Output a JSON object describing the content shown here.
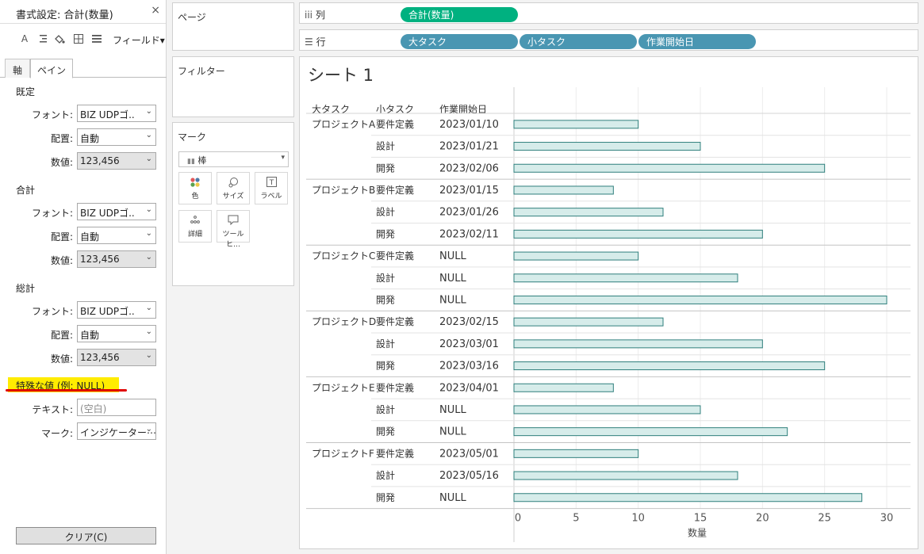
{
  "format_pane": {
    "title": "書式設定: 合計(数量)",
    "close": "×",
    "toolbar": {
      "font_icon": "A",
      "field_label": "フィールド▾"
    },
    "tabs": [
      "軸",
      "ペイン"
    ],
    "sections": [
      {
        "title": "既定",
        "rows": [
          {
            "label": "フォント:",
            "value": "BIZ UDPゴ..",
            "style": "white"
          },
          {
            "label": "配置:",
            "value": "自動",
            "style": "white"
          },
          {
            "label": "数値:",
            "value": "123,456",
            "style": "grey"
          }
        ]
      },
      {
        "title": "合計",
        "rows": [
          {
            "label": "フォント:",
            "value": "BIZ UDPゴ..",
            "style": "white"
          },
          {
            "label": "配置:",
            "value": "自動",
            "style": "white"
          },
          {
            "label": "数値:",
            "value": "123,456",
            "style": "grey"
          }
        ]
      },
      {
        "title": "総計",
        "rows": [
          {
            "label": "フォント:",
            "value": "BIZ UDPゴ..",
            "style": "white"
          },
          {
            "label": "配置:",
            "value": "自動",
            "style": "white"
          },
          {
            "label": "数値:",
            "value": "123,456",
            "style": "grey"
          }
        ]
      }
    ],
    "special": {
      "title": "特殊な値 (例: NULL)",
      "text_label": "テキスト:",
      "text_placeholder": "(空白)",
      "marks_label": "マーク:",
      "marks_value": "インジケーター⋯"
    },
    "clear_button": "クリア(C)"
  },
  "pages_card": {
    "title": "ページ"
  },
  "filters_card": {
    "title": "フィルター"
  },
  "marks_card": {
    "title": "マーク",
    "type": "棒",
    "buttons": [
      "色",
      "サイズ",
      "ラベル",
      "詳細",
      "ツールヒ…"
    ]
  },
  "shelves": {
    "columns": {
      "label": "列",
      "pills": [
        "合計(数量)"
      ]
    },
    "rows": {
      "label": "行",
      "pills": [
        "大タスク",
        "小タスク",
        "作業開始日"
      ]
    }
  },
  "sheet": {
    "title": "シート 1",
    "headers": [
      "大タスク",
      "小タスク",
      "作業開始日"
    ]
  },
  "colors": {
    "bar_fill": "#d6ecea",
    "bar_stroke": "#2f7f7c",
    "pill_green": "#00b180",
    "pill_blue": "#4996b2",
    "highlight": "#ffec00",
    "underline": "#e00000"
  },
  "chart_data": {
    "type": "bar",
    "orientation": "horizontal",
    "xlabel": "数量",
    "xlim": [
      0,
      32
    ],
    "xticks": [
      0,
      5,
      10,
      15,
      20,
      25,
      30
    ],
    "grid": true,
    "rows": [
      {
        "group": "プロジェクトA",
        "task": "要件定義",
        "date": "2023/01/10",
        "value": 10
      },
      {
        "group": "",
        "task": "設計",
        "date": "2023/01/21",
        "value": 15
      },
      {
        "group": "",
        "task": "開発",
        "date": "2023/02/06",
        "value": 25
      },
      {
        "group": "プロジェクトB",
        "task": "要件定義",
        "date": "2023/01/15",
        "value": 8
      },
      {
        "group": "",
        "task": "設計",
        "date": "2023/01/26",
        "value": 12
      },
      {
        "group": "",
        "task": "開発",
        "date": "2023/02/11",
        "value": 20
      },
      {
        "group": "プロジェクトC",
        "task": "要件定義",
        "date": "NULL",
        "value": 10
      },
      {
        "group": "",
        "task": "設計",
        "date": "NULL",
        "value": 18
      },
      {
        "group": "",
        "task": "開発",
        "date": "NULL",
        "value": 30
      },
      {
        "group": "プロジェクトD",
        "task": "要件定義",
        "date": "2023/02/15",
        "value": 12
      },
      {
        "group": "",
        "task": "設計",
        "date": "2023/03/01",
        "value": 20
      },
      {
        "group": "",
        "task": "開発",
        "date": "2023/03/16",
        "value": 25
      },
      {
        "group": "プロジェクトE",
        "task": "要件定義",
        "date": "2023/04/01",
        "value": 8
      },
      {
        "group": "",
        "task": "設計",
        "date": "NULL",
        "value": 15
      },
      {
        "group": "",
        "task": "開発",
        "date": "NULL",
        "value": 22
      },
      {
        "group": "プロジェクトF",
        "task": "要件定義",
        "date": "2023/05/01",
        "value": 10
      },
      {
        "group": "",
        "task": "設計",
        "date": "2023/05/16",
        "value": 18
      },
      {
        "group": "",
        "task": "開発",
        "date": "NULL",
        "value": 28
      }
    ]
  }
}
